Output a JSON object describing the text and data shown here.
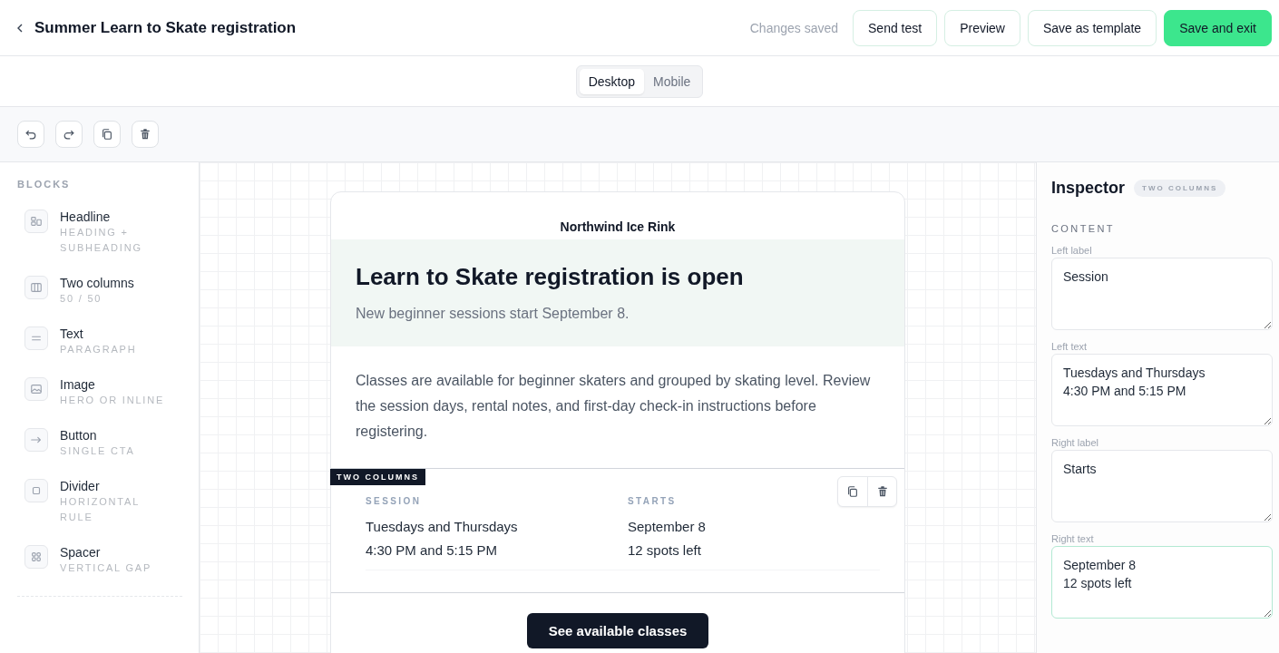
{
  "header": {
    "title": "Summer Learn to Skate registration",
    "status": "Changes saved",
    "buttons": [
      {
        "label": "Send test",
        "primary": false
      },
      {
        "label": "Preview",
        "primary": false
      },
      {
        "label": "Save as template",
        "primary": false
      },
      {
        "label": "Save and exit",
        "primary": true
      }
    ]
  },
  "view_toggle": [
    {
      "label": "Desktop",
      "selected": true
    },
    {
      "label": "Mobile",
      "selected": false
    }
  ],
  "blocks": {
    "title": "BLOCKS",
    "items": [
      {
        "kind": "headline",
        "name": "Headline",
        "hint": "HEADING + SUBHEADING"
      },
      {
        "kind": "columns",
        "name": "Two columns",
        "hint": "50 / 50"
      },
      {
        "kind": "text",
        "name": "Text",
        "hint": "PARAGRAPH"
      },
      {
        "kind": "image",
        "name": "Image",
        "hint": "HERO OR INLINE"
      },
      {
        "kind": "button",
        "name": "Button",
        "hint": "SINGLE CTA"
      },
      {
        "kind": "divider",
        "name": "Divider",
        "hint": "HORIZONTAL RULE"
      },
      {
        "kind": "spacer",
        "name": "Spacer",
        "hint": "VERTICAL GAP"
      }
    ]
  },
  "email": {
    "brand": "Northwind Ice Rink",
    "hero": {
      "title": "Learn to Skate registration is open",
      "subtitle": "New beginner sessions start September 8."
    },
    "body": "Classes are available for beginner skaters and grouped by skating level. Review the session days, rental notes, and first-day check-in instructions before registering.",
    "two_columns": {
      "tag": "TWO COLUMNS",
      "selected": true,
      "columns": [
        {
          "label": "SESSION",
          "lines": [
            "Tuesdays and Thursdays",
            "4:30 PM and 5:15 PM"
          ]
        },
        {
          "label": "STARTS",
          "lines": [
            "September 8",
            "12 spots left"
          ]
        }
      ]
    },
    "cta": "See available classes"
  },
  "inspector": {
    "title": "Inspector",
    "badge": "TWO COLUMNS",
    "section": "CONTENT",
    "fields": [
      {
        "label": "Left label",
        "value": "Session",
        "focused": false
      },
      {
        "label": "Left text",
        "value": "Tuesdays and Thursdays\n4:30 PM and 5:15 PM",
        "focused": false
      },
      {
        "label": "Right label",
        "value": "Starts",
        "focused": false
      },
      {
        "label": "Right text",
        "value": "September 8\n12 spots left",
        "focused": true
      }
    ]
  }
}
